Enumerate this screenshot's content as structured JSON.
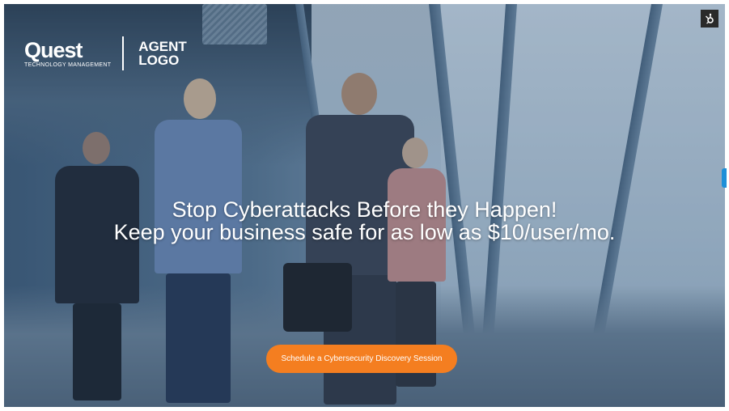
{
  "logo": {
    "brand_name": "Quest",
    "brand_tagline": "TECHNOLOGY MANAGEMENT",
    "agent_line1": "AGENT",
    "agent_line2": "LOGO"
  },
  "hero": {
    "headline_line1": "Stop Cyberattacks Before they Happen!",
    "headline_line2": "Keep your business safe for as low as $10/user/mo."
  },
  "cta": {
    "label": "Schedule a Cybersecurity Discovery Session",
    "color": "#f47e20"
  },
  "widgets": {
    "corner_icon": "hubspot-sprocket-icon",
    "side_tab_icon": "chat-tab-icon",
    "side_tab_color": "#1d8fd8"
  }
}
